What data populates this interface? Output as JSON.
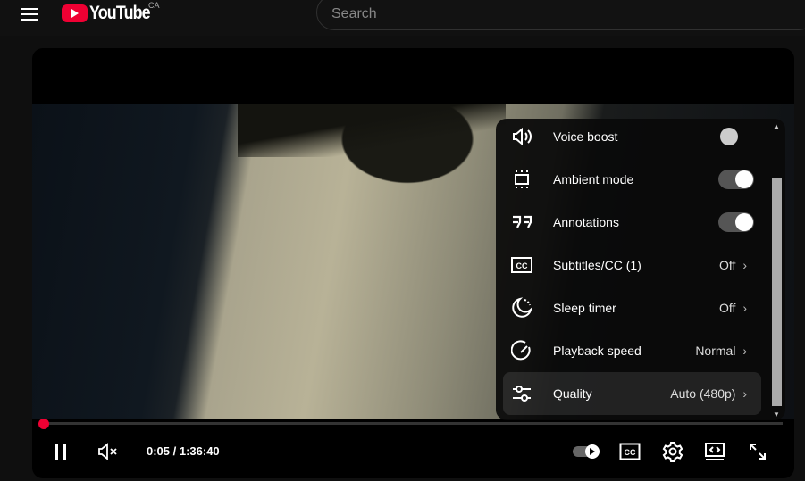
{
  "header": {
    "logo_text": "YouTube",
    "country": "CA",
    "search_placeholder": "Search"
  },
  "player": {
    "menu": [
      {
        "icon": "voice-boost-icon",
        "label": "Voice boost",
        "control": "toggle-disabled"
      },
      {
        "icon": "ambient-mode-icon",
        "label": "Ambient mode",
        "control": "toggle",
        "on": true
      },
      {
        "icon": "annotations-icon",
        "label": "Annotations",
        "control": "toggle",
        "on": true
      },
      {
        "icon": "subtitles-icon",
        "label": "Subtitles/CC (1)",
        "value": "Off"
      },
      {
        "icon": "sleep-timer-icon",
        "label": "Sleep timer",
        "value": "Off"
      },
      {
        "icon": "playback-speed-icon",
        "label": "Playback speed",
        "value": "Normal"
      },
      {
        "icon": "quality-icon",
        "label": "Quality",
        "value": "Auto (480p)"
      }
    ],
    "time": "0:05 / 1:36:40",
    "progress_fraction": 0.0009,
    "accent": "#ff0033"
  }
}
